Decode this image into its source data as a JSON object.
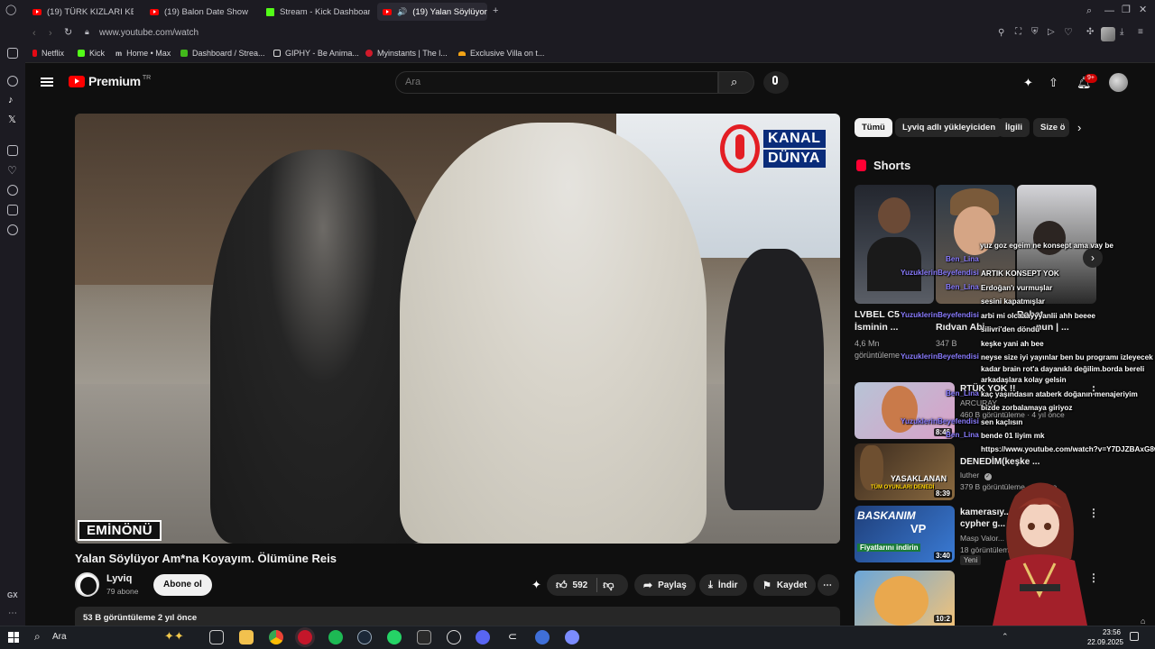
{
  "browser": {
    "tabs": [
      {
        "label": "(19) TÜRK KIZLARI KEKO"
      },
      {
        "label": "(19) Balon Date Show 23"
      },
      {
        "label": "Stream - Kick Dashboard"
      },
      {
        "label": "(19) Yalan Söylüyor A"
      }
    ],
    "url": "www.youtube.com/watch",
    "bookmarks": [
      {
        "label": "Netflix"
      },
      {
        "label": "Kick"
      },
      {
        "label": "Home • Max"
      },
      {
        "label": "Dashboard / Strea..."
      },
      {
        "label": "GIPHY - Be Anima..."
      },
      {
        "label": "Myinstants | The l..."
      },
      {
        "label": "Exclusive Villa on t..."
      }
    ],
    "side_label": "GX"
  },
  "youtube": {
    "logo": "Premium",
    "logo_region": "TR",
    "search_placeholder": "Ara",
    "notif_count": "9+",
    "video": {
      "channel_logo_top": "KANAL",
      "channel_logo_bottom": "DÜNYA",
      "location": "EMİNÖNÜ",
      "title": "Yalan Söylüyor Am*na Koyayım. Ölümüne Reis",
      "channel": "Lyviq",
      "subs": "79 abone",
      "subscribe": "Abone ol",
      "likes": "592",
      "share": "Paylaş",
      "download": "İndir",
      "save": "Kaydet",
      "views_time": "53 B görüntüleme  2 yıl önce"
    },
    "chips": [
      "Tümü",
      "Lyviq adlı yükleyiciden",
      "İlgili",
      "Size ö"
    ],
    "shorts_title": "Shorts",
    "shorts": [
      {
        "title_1": "LVBEL C5",
        "title_2": "İsminin ...",
        "meta_1": "4,6 Mn",
        "meta_2": "görüntüleme"
      },
      {
        "title_1": "Rahat",
        "title_2": "Rıdvan Abi",
        "meta_1": "347 B",
        "meta_2": ""
      },
      {
        "title_1": "",
        "title_2": "nun | ...",
        "meta_1": "",
        "meta_2": ""
      }
    ],
    "recommendations": [
      {
        "title_1": "RTÜK YOK !!",
        "title_2": "",
        "channel": "ARCURAY",
        "meta": "460 B görüntüleme · 4 yıl önce",
        "duration": "8:46"
      },
      {
        "title_1": "DENEDİM(keşke ...",
        "title_2": "",
        "channel": "luther",
        "meta": "379 B görüntüleme · ... önce",
        "duration": "8:39"
      },
      {
        "title_1": "kamerasıy...",
        "title_2": "cypher g...",
        "channel": "Masp Valor...",
        "meta": "18 görüntüleme · ... önce",
        "duration": "3:40",
        "badge": "Yeni"
      },
      {
        "title_1": "",
        "title_2": "",
        "channel": "",
        "meta": "",
        "duration": "10:2"
      }
    ],
    "thumb_texts": {
      "rec2_overlay": "YASAKLANAN",
      "rec2_overlay2": "TÜM OYUNLARI DENEDİ",
      "rec3_overlay": "BASKANIM",
      "rec3_overlay2": "VP",
      "rec3_overlay3": "Fiyatlarını indirin"
    }
  },
  "chat": [
    {
      "user": "",
      "text": "yuz goz egeim ne konsept ama vay be"
    },
    {
      "user": "Ben_Lina",
      "text": ""
    },
    {
      "user": "YuzuklerinBeyefendisi",
      "text": "ARTIK KONSEPT YOK"
    },
    {
      "user": "Ben_Lina",
      "text": "Erdoğan'ı vurmuşlar"
    },
    {
      "user": "",
      "text": "sesini kapatmışlar"
    },
    {
      "user": "YuzuklerinBeyefendisi",
      "text": "arbi mi olcaaayyyanlii ahh beeee"
    },
    {
      "user": "",
      "text": "silivri'den döndü"
    },
    {
      "user": "",
      "text": "keşke yani ah bee"
    },
    {
      "user": "YuzuklerinBeyefendisi",
      "text": "neyse size iyi yayınlar ben bu programı izleyecek"
    },
    {
      "user": "",
      "text": "kadar brain rot'a dayanıklı değilim.borda bereli"
    },
    {
      "user": "",
      "text": "arkadaşlara kolay gelsin"
    },
    {
      "user": "Ben_Lina",
      "text": "kaç yaşındasın ataberk doğanın menajeriyim"
    },
    {
      "user": "",
      "text": "bizde zorbalamaya giriyoz"
    },
    {
      "user": "YuzuklerinBeyefendisi",
      "text": "sen kaçlısın"
    },
    {
      "user": "Ben_Lina",
      "text": "bende 01 liyim mk"
    },
    {
      "user": "",
      "text": "https://www.youtube.com/watch?v=Y7DJZBAxG8w"
    }
  ],
  "taskbar": {
    "search": "Ara",
    "time": "23:56",
    "date": "22.09.2025"
  },
  "colors": {
    "yt_red": "#ff0000",
    "chat_user_purple": "#8a7cff",
    "chat_user_pink": "#ff4fa0"
  }
}
